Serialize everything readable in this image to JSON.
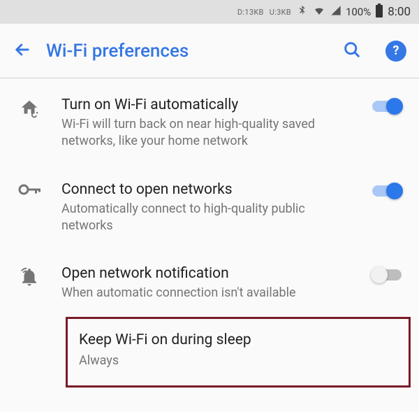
{
  "status": {
    "down": "D:13KB",
    "up": "U:3KB",
    "battery_pct": "100%",
    "time": "8:00"
  },
  "header": {
    "title": "Wi-Fi preferences",
    "help_glyph": "?"
  },
  "rows": [
    {
      "title": "Turn on Wi-Fi automatically",
      "sub": "Wi-Fi will turn back on near high-quality saved networks, like your home network",
      "switch": true
    },
    {
      "title": "Connect to open networks",
      "sub": "Automatically connect to high-quality public networks",
      "switch": true
    },
    {
      "title": "Open network notification",
      "sub": "When automatic connection isn't available",
      "switch": false
    }
  ],
  "highlight": {
    "title": "Keep Wi-Fi on during sleep",
    "sub": "Always"
  }
}
